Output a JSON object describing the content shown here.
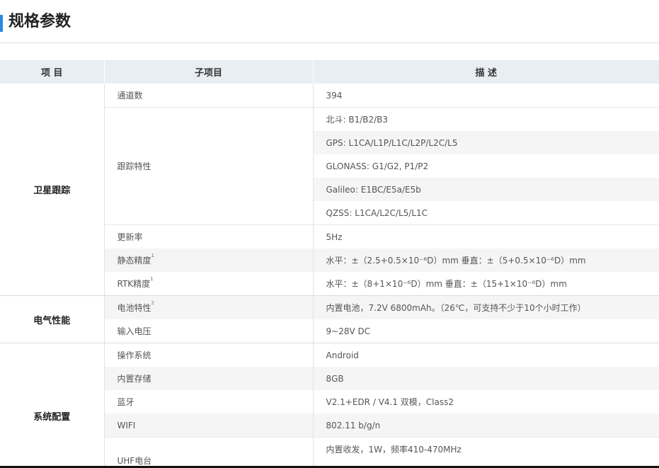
{
  "page": {
    "title": "规格参数"
  },
  "table": {
    "headers": {
      "category": "项 目",
      "subitem": "子项目",
      "description": "描 述"
    },
    "groups": [
      {
        "category": "卫星跟踪",
        "rows": [
          {
            "sub": "通道数",
            "desc": [
              "394"
            ]
          },
          {
            "sub": "跟踪特性",
            "desc": [
              "北斗: B1/B2/B3",
              "GPS: L1CA/L1P/L1C/L2P/L2C/L5",
              "GLONASS: G1/G2, P1/P2",
              "Galileo: E1BC/E5a/E5b",
              "QZSS: L1CA/L2C/L5/L1C"
            ]
          },
          {
            "sub": "更新率",
            "desc": [
              "5Hz"
            ]
          },
          {
            "sub": "静态精度",
            "sup": "1",
            "desc": [
              "水平：±（2.5+0.5×10⁻⁶D）mm  垂直：±（5+0.5×10⁻⁶D）mm"
            ]
          },
          {
            "sub": "RTK精度",
            "sup": "1",
            "desc": [
              "水平：±（8+1×10⁻⁶D）mm  垂直：±（15+1×10⁻⁶D）mm"
            ]
          }
        ]
      },
      {
        "category": "电气性能",
        "rows": [
          {
            "sub": "电池特性",
            "sup": "2",
            "desc": [
              "内置电池，7.2V 6800mAh。（26℃，可支持不少于10个小时工作）"
            ]
          },
          {
            "sub": "输入电压",
            "desc": [
              "9~28V DC"
            ]
          }
        ]
      },
      {
        "category": "系统配置",
        "rows": [
          {
            "sub": "操作系统",
            "desc": [
              "Android"
            ]
          },
          {
            "sub": "内置存储",
            "desc": [
              "8GB"
            ]
          },
          {
            "sub": "蓝牙",
            "desc": [
              "V2.1+EDR / V4.1 双模，Class2"
            ]
          },
          {
            "sub": "WIFI",
            "desc": [
              "802.11 b/g/n"
            ]
          },
          {
            "sub": "UHF电台",
            "desc": [
              "内置收发，1W，频率410-470MHz"
            ]
          }
        ]
      }
    ]
  }
}
